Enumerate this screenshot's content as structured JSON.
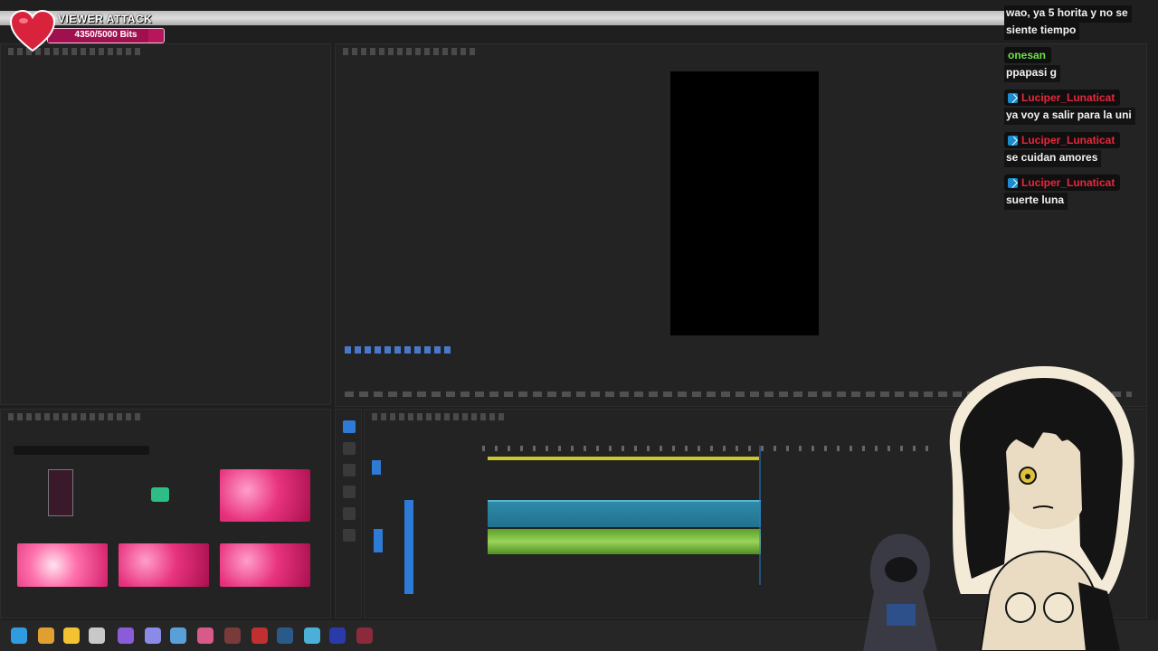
{
  "overlay": {
    "title": "VIEWER ATTACK",
    "bits_label": "4350/5000 Bits",
    "bits_fraction": 0.87
  },
  "chat": {
    "messages": [
      {
        "user": "",
        "text": "wao, ya 5 horita y no se"
      },
      {
        "user": "",
        "text": "siente tiempo"
      },
      {
        "user": "onesan",
        "user_color": "#6de04a",
        "badge": false,
        "text": "ppapasi g"
      },
      {
        "user": "Luciper_Lunaticat",
        "user_color": "#e8273c",
        "badge": true,
        "text": "ya voy a salir para la uni"
      },
      {
        "user": "Luciper_Lunaticat",
        "user_color": "#e8273c",
        "badge": true,
        "text": "se cuidan amores"
      },
      {
        "user": "Luciper_Lunaticat",
        "user_color": "#e8273c",
        "badge": true,
        "text": "suerte luna"
      }
    ]
  },
  "colors": {
    "accent": "#2e7bd6",
    "video_clip": "#2d8ba8",
    "audio_clip": "#7fbf3f",
    "bits_bar": "#b6165b"
  },
  "icons": {
    "heart": "heart-icon",
    "prime_badge": "prime-badge-icon"
  }
}
